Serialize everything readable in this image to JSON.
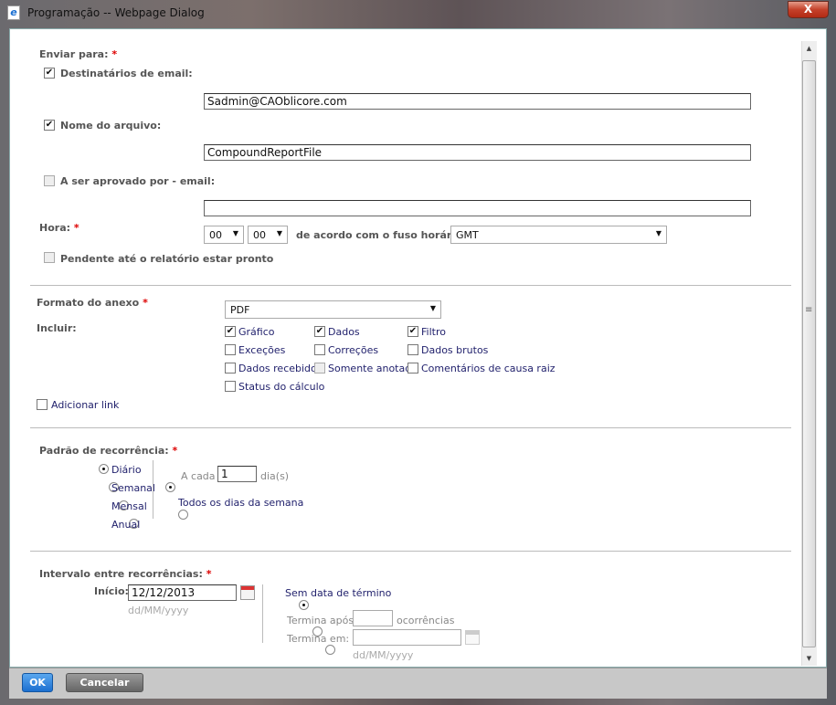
{
  "window": {
    "title": "Programação -- Webpage Dialog",
    "close": "X",
    "ie_icon": "e"
  },
  "send": {
    "label": "Enviar para:",
    "req": "*",
    "email_recipients": {
      "label": "Destinatários de email:",
      "checked": true,
      "value": "Sadmin@CAOblicore.com"
    },
    "file_name": {
      "label": "Nome do arquivo:",
      "checked": true,
      "value": "CompoundReportFile"
    },
    "approval": {
      "label": "A ser aprovado por - email:",
      "checked": false,
      "value": ""
    },
    "time": {
      "label": "Hora:",
      "req": "*",
      "hour": "00",
      "minute": "00",
      "tz_label": "de acordo com o fuso horário",
      "tz": "GMT"
    },
    "pending": {
      "label": "Pendente até o relatório estar pronto",
      "checked": false
    }
  },
  "attachment": {
    "label": "Formato do anexo",
    "req": "*",
    "format": "PDF",
    "include_label": "Incluir:",
    "options": [
      {
        "label": "Gráfico",
        "checked": true
      },
      {
        "label": "Dados",
        "checked": true
      },
      {
        "label": "Filtro",
        "checked": true
      },
      {
        "label": "Exceções",
        "checked": false
      },
      {
        "label": "Correções",
        "checked": false
      },
      {
        "label": "Dados brutos",
        "checked": false
      },
      {
        "label": "Dados recebidos",
        "checked": false
      },
      {
        "label": "Somente anotado",
        "checked": false
      },
      {
        "label": "Comentários de causa raiz",
        "checked": false
      },
      {
        "label": "Status do cálculo",
        "checked": false
      }
    ],
    "add_link": {
      "label": "Adicionar link",
      "checked": false
    }
  },
  "recurrence": {
    "label": "Padrão de recorrência:",
    "req": "*",
    "patterns": [
      {
        "label": "Diário",
        "selected": true
      },
      {
        "label": "Semanal",
        "selected": false
      },
      {
        "label": "Mensal",
        "selected": false
      },
      {
        "label": "Anual",
        "selected": false
      }
    ],
    "every_label": "A cada",
    "every_value": "1",
    "every_unit": "dia(s)",
    "weekdays_label": "Todos os dias da semana"
  },
  "range": {
    "label": "Intervalo entre recorrências:",
    "req": "*",
    "start_label": "Início:",
    "start_value": "12/12/2013",
    "date_format": "dd/MM/yyyy",
    "no_end": "Sem data de término",
    "end_after": "Termina após:",
    "occurrences": "ocorrências",
    "end_on": "Termina em:",
    "end_date_format": "dd/MM/yyyy"
  },
  "footer": {
    "ok": "OK",
    "cancel": "Cancelar"
  }
}
